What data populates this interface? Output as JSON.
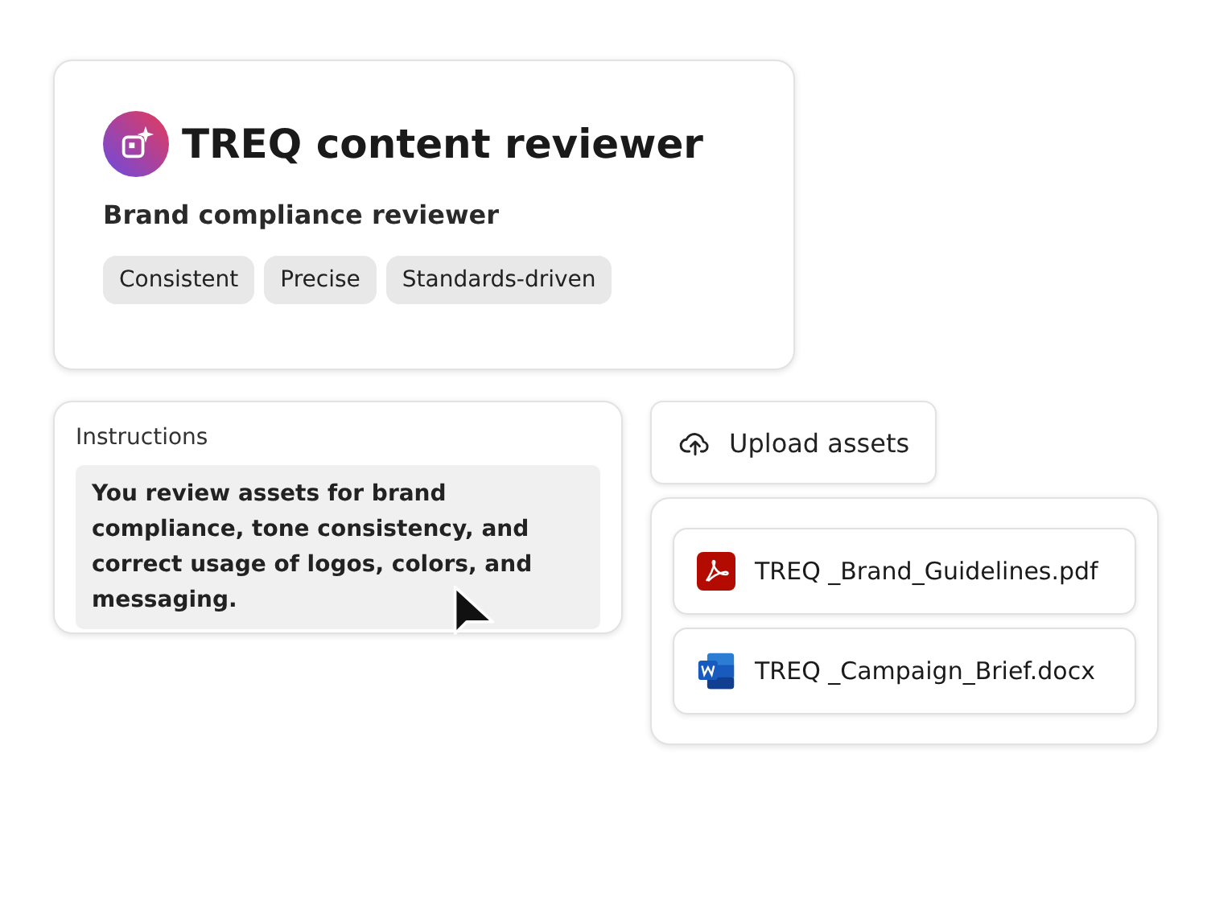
{
  "agent": {
    "title": "TREQ content reviewer",
    "subtitle": "Brand compliance reviewer",
    "tags": [
      "Consistent",
      "Precise",
      "Standards-driven"
    ]
  },
  "instructions": {
    "label": "Instructions",
    "text": "You review assets for brand compliance, tone consistency, and correct usage of logos, colors, and messaging."
  },
  "upload": {
    "label": "Upload assets"
  },
  "files": [
    {
      "kind": "pdf",
      "name": "TREQ _Brand_Guidelines.pdf"
    },
    {
      "kind": "word",
      "name": "TREQ _Campaign_Brief.docx"
    }
  ]
}
